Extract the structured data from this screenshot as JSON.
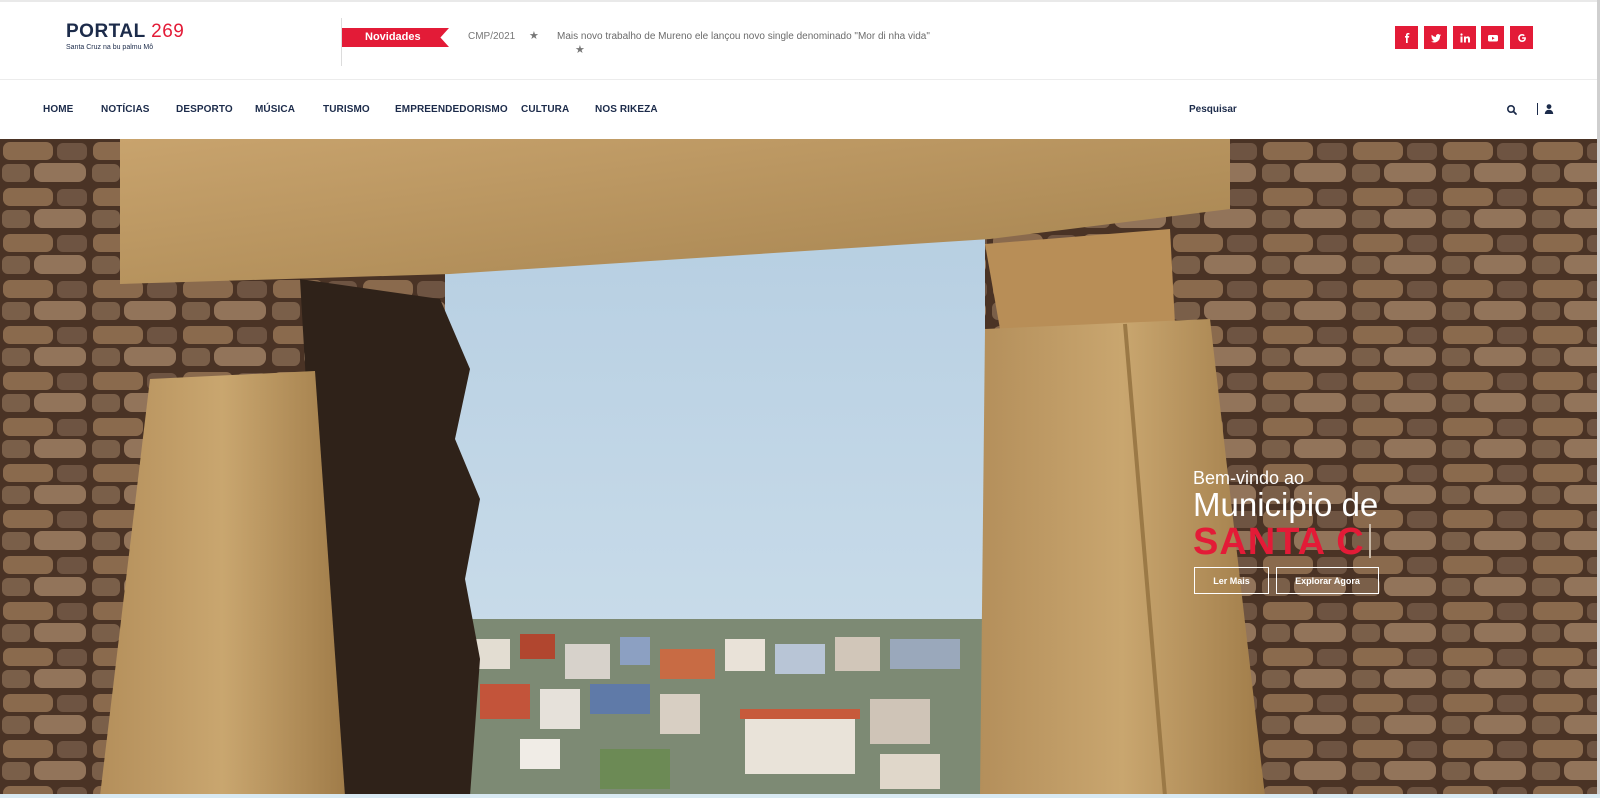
{
  "header": {
    "logo_title": "PORTAL",
    "logo_number": "269",
    "logo_tagline": "Santa Cruz na bu palmu Mô"
  },
  "news": {
    "badge": "Novidades",
    "date": "CMP/2021",
    "headline": "Mais novo trabalho de Mureno ele lançou novo single denominado \"Mor di nha vida\""
  },
  "social": [
    {
      "icon": "facebook-icon",
      "label": "f"
    },
    {
      "icon": "twitter-icon",
      "label": "t"
    },
    {
      "icon": "linkedin-icon",
      "label": "in"
    },
    {
      "icon": "youtube-icon",
      "label": "yt"
    },
    {
      "icon": "google-icon",
      "label": "G"
    }
  ],
  "nav": {
    "items": [
      "HOME",
      "NOTÍCIAS",
      "DESPORTO",
      "MÚSICA",
      "TURISMO",
      "EMPREENDEDORISMO",
      "CULTURA",
      "NOS RIKEZA"
    ],
    "search_label": "Pesquisar"
  },
  "hero": {
    "welcome": "Bem-vindo ao",
    "title": "Municipio de",
    "name": "SANTA C",
    "buttons": [
      "Ler Mais",
      "Explorar Agora"
    ]
  },
  "colors": {
    "accent": "#e31b37",
    "navy": "#1c2b4a"
  }
}
